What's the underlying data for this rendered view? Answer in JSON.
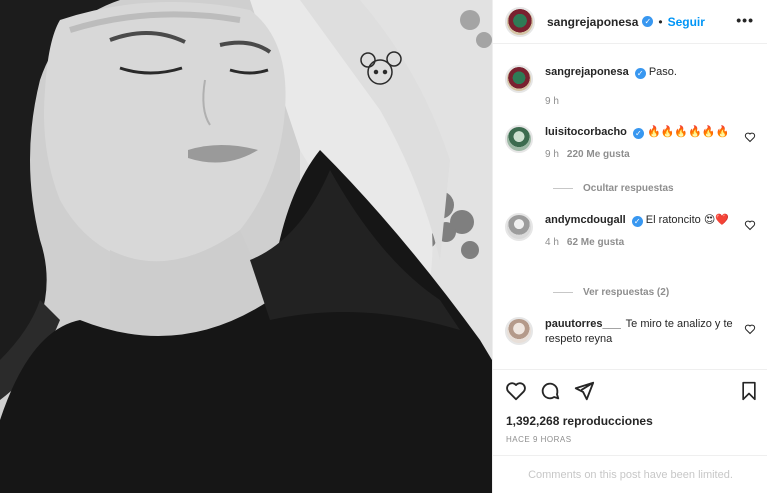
{
  "post": {
    "author": "sangrejaponesa",
    "follow_label": "Seguir",
    "dot": "•",
    "more_label": "•••",
    "verified_mark": "✓"
  },
  "caption": {
    "author": "sangrejaponesa",
    "text": "Paso.",
    "time": "9 h"
  },
  "comments": [
    {
      "user": "luisitocorbacho",
      "text": "🔥🔥🔥🔥🔥🔥",
      "time": "9 h",
      "likes": "220 Me gusta",
      "verified": true
    },
    {
      "user": "andymcdougall",
      "text": "El ratoncito 😍❤️",
      "time": "4 h",
      "likes": "62 Me gusta",
      "verified": true
    },
    {
      "user": "pauutorres___",
      "text": "Te miro te analizo y te respeto reyna",
      "time": "",
      "likes": "",
      "verified": false
    }
  ],
  "replies": {
    "hide_label": "Ocultar respuestas",
    "view_label": "Ver respuestas (2)"
  },
  "footer": {
    "views": "1,392,268 reproducciones",
    "ago": "HACE 9 HORAS",
    "limited": "Comments on this post have been limited."
  },
  "icons": [
    "heart-icon",
    "comment-icon",
    "share-icon",
    "bookmark-icon",
    "more-icon",
    "verified-icon"
  ],
  "colors": {
    "accent": "#0095f6",
    "verified": "#3897f0",
    "muted": "#8e8e8e"
  }
}
